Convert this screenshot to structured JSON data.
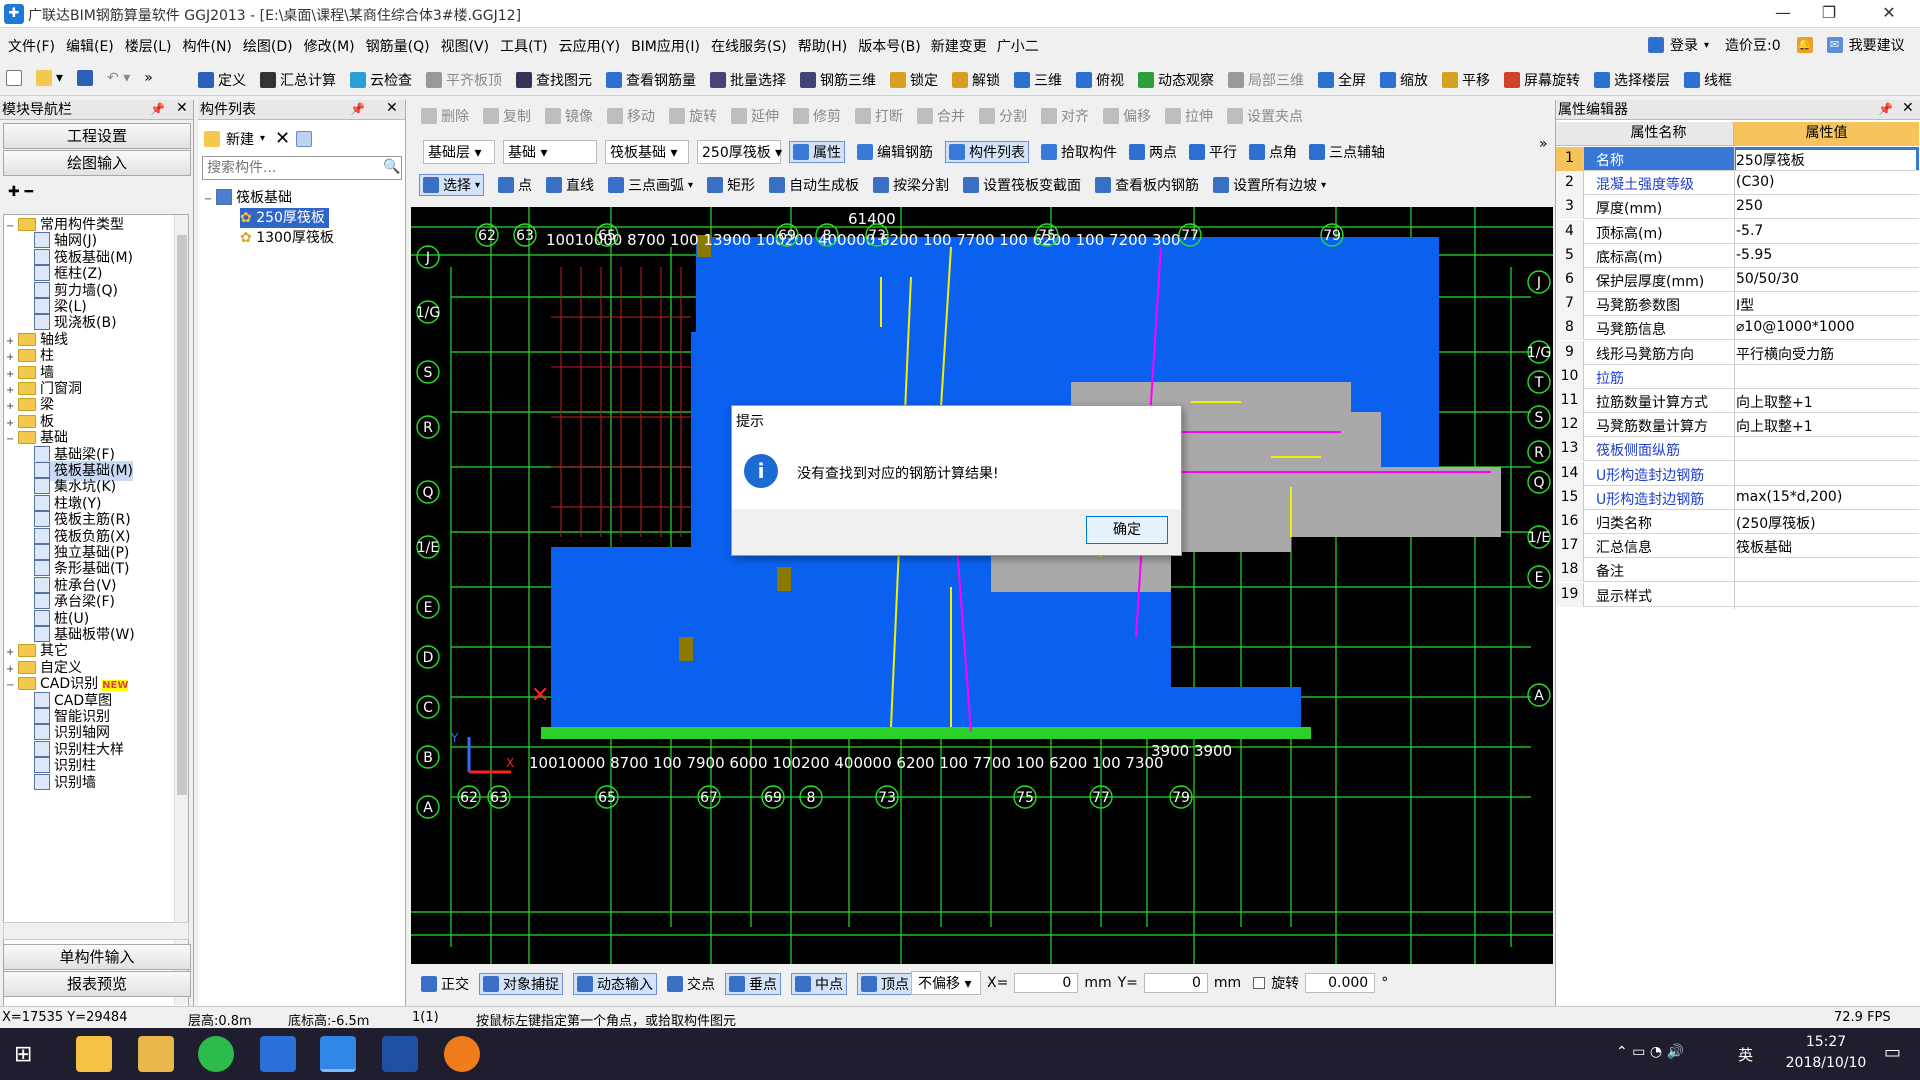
{
  "window": {
    "title": "广联达BIM钢筋算量软件 GGJ2013 - [E:\\桌面\\课程\\某商住综合体3#楼.GGJ12]"
  },
  "menu": [
    "文件(F)",
    "编辑(E)",
    "楼层(L)",
    "构件(N)",
    "绘图(D)",
    "修改(M)",
    "钢筋量(Q)",
    "视图(V)",
    "工具(T)",
    "云应用(Y)",
    "BIM应用(I)",
    "在线服务(S)",
    "帮助(H)",
    "版本号(B)",
    "新建变更",
    "广小二"
  ],
  "menu_right": {
    "login": "登录",
    "price": "造价豆:0",
    "suggest": "我要建议"
  },
  "toolbar1": [
    "定义",
    "汇总计算",
    "云检查",
    "平齐板顶",
    "查找图元",
    "查看钢筋量",
    "批量选择",
    "钢筋三维",
    "锁定",
    "解锁",
    "三维",
    "俯视",
    "动态观察",
    "局部三维",
    "全屏",
    "缩放",
    "平移",
    "屏幕旋转",
    "选择楼层",
    "线框"
  ],
  "nav": {
    "title": "模块导航栏",
    "btn_project": "工程设置",
    "btn_draw": "绘图输入",
    "btn_single": "单构件输入",
    "btn_report": "报表预览",
    "tree": [
      {
        "t": "常用构件类型",
        "lvl": 0,
        "k": "folder",
        "e": "−"
      },
      {
        "t": "轴网(J)",
        "lvl": 2,
        "k": "item"
      },
      {
        "t": "筏板基础(M)",
        "lvl": 2,
        "k": "item"
      },
      {
        "t": "框柱(Z)",
        "lvl": 2,
        "k": "item"
      },
      {
        "t": "剪力墙(Q)",
        "lvl": 2,
        "k": "item"
      },
      {
        "t": "梁(L)",
        "lvl": 2,
        "k": "item"
      },
      {
        "t": "现浇板(B)",
        "lvl": 2,
        "k": "item"
      },
      {
        "t": "轴线",
        "lvl": 0,
        "k": "folder",
        "e": "+"
      },
      {
        "t": "柱",
        "lvl": 0,
        "k": "folder",
        "e": "+"
      },
      {
        "t": "墙",
        "lvl": 0,
        "k": "folder",
        "e": "+"
      },
      {
        "t": "门窗洞",
        "lvl": 0,
        "k": "folder",
        "e": "+"
      },
      {
        "t": "梁",
        "lvl": 0,
        "k": "folder",
        "e": "+"
      },
      {
        "t": "板",
        "lvl": 0,
        "k": "folder",
        "e": "+"
      },
      {
        "t": "基础",
        "lvl": 0,
        "k": "folder",
        "e": "−"
      },
      {
        "t": "基础梁(F)",
        "lvl": 2,
        "k": "item"
      },
      {
        "t": "筏板基础(M)",
        "lvl": 2,
        "k": "item",
        "sel": true
      },
      {
        "t": "集水坑(K)",
        "lvl": 2,
        "k": "item"
      },
      {
        "t": "柱墩(Y)",
        "lvl": 2,
        "k": "item"
      },
      {
        "t": "筏板主筋(R)",
        "lvl": 2,
        "k": "item"
      },
      {
        "t": "筏板负筋(X)",
        "lvl": 2,
        "k": "item"
      },
      {
        "t": "独立基础(P)",
        "lvl": 2,
        "k": "item"
      },
      {
        "t": "条形基础(T)",
        "lvl": 2,
        "k": "item"
      },
      {
        "t": "桩承台(V)",
        "lvl": 2,
        "k": "item"
      },
      {
        "t": "承台梁(F)",
        "lvl": 2,
        "k": "item"
      },
      {
        "t": "桩(U)",
        "lvl": 2,
        "k": "item"
      },
      {
        "t": "基础板带(W)",
        "lvl": 2,
        "k": "item"
      },
      {
        "t": "其它",
        "lvl": 0,
        "k": "folder",
        "e": "+"
      },
      {
        "t": "自定义",
        "lvl": 0,
        "k": "folder",
        "e": "+"
      },
      {
        "t": "CAD识别",
        "lvl": 0,
        "k": "folder",
        "e": "−",
        "badge": "NEW"
      },
      {
        "t": "CAD草图",
        "lvl": 2,
        "k": "item"
      },
      {
        "t": "智能识别",
        "lvl": 2,
        "k": "item"
      },
      {
        "t": "识别轴网",
        "lvl": 2,
        "k": "item"
      },
      {
        "t": "识别柱大样",
        "lvl": 2,
        "k": "item"
      },
      {
        "t": "识别柱",
        "lvl": 2,
        "k": "item"
      },
      {
        "t": "识别墙",
        "lvl": 2,
        "k": "item"
      }
    ]
  },
  "complist": {
    "title": "构件列表",
    "new": "新建",
    "search_ph": "搜索构件...",
    "root": "筏板基础",
    "items": [
      "250厚筏板",
      "1300厚筏板"
    ]
  },
  "layerbar": {
    "floor": "基础层",
    "type": "基础",
    "sub": "筏板基础",
    "comp": "250厚筏板",
    "buttons": [
      "属性",
      "编辑钢筋",
      "构件列表",
      "拾取构件",
      "两点",
      "平行",
      "点角",
      "三点辅轴"
    ]
  },
  "editbar": [
    "删除",
    "复制",
    "镜像",
    "移动",
    "旋转",
    "延伸",
    "修剪",
    "打断",
    "合并",
    "分割",
    "对齐",
    "偏移",
    "拉伸",
    "设置夹点"
  ],
  "drawbar": [
    "选择",
    "点",
    "直线",
    "三点画弧",
    "矩形",
    "自动生成板",
    "按梁分割",
    "设置筏板变截面",
    "查看板内钢筋",
    "设置所有边坡"
  ],
  "props": {
    "title": "属性编辑器",
    "h_name": "属性名称",
    "h_val": "属性值",
    "rows": [
      {
        "n": "1",
        "k": "名称",
        "v": "250厚筏板",
        "blue": false
      },
      {
        "n": "2",
        "k": "混凝土强度等级",
        "v": "(C30)",
        "blue": true
      },
      {
        "n": "3",
        "k": "厚度(mm)",
        "v": "250",
        "blue": false
      },
      {
        "n": "4",
        "k": "顶标高(m)",
        "v": "-5.7",
        "blue": false
      },
      {
        "n": "5",
        "k": "底标高(m)",
        "v": "-5.95",
        "blue": false
      },
      {
        "n": "6",
        "k": "保护层厚度(mm)",
        "v": "50/50/30",
        "blue": false
      },
      {
        "n": "7",
        "k": "马凳筋参数图",
        "v": "Ⅰ型",
        "blue": false
      },
      {
        "n": "8",
        "k": "马凳筋信息",
        "v": "⌀10@1000*1000",
        "blue": false
      },
      {
        "n": "9",
        "k": "线形马凳筋方向",
        "v": "平行横向受力筋",
        "blue": false
      },
      {
        "n": "10",
        "k": "拉筋",
        "v": "",
        "blue": true
      },
      {
        "n": "11",
        "k": "拉筋数量计算方式",
        "v": "向上取整+1",
        "blue": false
      },
      {
        "n": "12",
        "k": "马凳筋数量计算方",
        "v": "向上取整+1",
        "blue": false
      },
      {
        "n": "13",
        "k": "筏板侧面纵筋",
        "v": "",
        "blue": true
      },
      {
        "n": "14",
        "k": "U形构造封边钢筋",
        "v": "",
        "blue": true
      },
      {
        "n": "15",
        "k": "U形构造封边钢筋",
        "v": "max(15*d,200)",
        "blue": true
      },
      {
        "n": "16",
        "k": "归类名称",
        "v": "(250厚筏板)",
        "blue": false
      },
      {
        "n": "17",
        "k": "汇总信息",
        "v": "筏板基础",
        "blue": false
      },
      {
        "n": "18",
        "k": "备注",
        "v": "",
        "blue": false
      },
      {
        "n": "19",
        "k": "显示样式",
        "v": "",
        "blue": false
      }
    ]
  },
  "dialog": {
    "title": "提示",
    "message": "没有查找到对应的钢筋计算结果!",
    "ok": "确定"
  },
  "cad": {
    "top_dims": "10010000  8700   100     13900     100200  400000  6200  100    7700    100  6200  100   7200   300",
    "bot_dims": "10010000   8700    100    7900       6000 100200  400000  6200  100    7700    100  6200  100    7300",
    "top_over": "61400",
    "bot_over": "3900  3900",
    "axes_top": [
      "62",
      "63",
      "65",
      "69",
      "8",
      "73",
      "75",
      "77",
      "79"
    ],
    "axes_bot": [
      "62",
      "63",
      "65",
      "67",
      "69",
      "8",
      "73",
      "75",
      "77",
      "79"
    ],
    "axes_left": [
      "J",
      "1/G",
      "S",
      "R",
      "Q",
      "1/E",
      "E",
      "D",
      "C",
      "B",
      "A"
    ],
    "axes_right": [
      "J",
      "1/G",
      "T",
      "S",
      "R",
      "Q",
      "1/E",
      "E",
      "A"
    ]
  },
  "snap": {
    "buttons": [
      "正交",
      "对象捕捉",
      "动态输入",
      "交点",
      "垂点",
      "中点",
      "顶点",
      "坐标"
    ],
    "offset": "不偏移",
    "x_label": "X=",
    "x": "0",
    "y_label": "Y=",
    "y": "0",
    "unit": "mm",
    "rotate_label": "旋转",
    "rotate": "0.000",
    "deg": "°"
  },
  "status": {
    "coords": "X=17535 Y=29484",
    "floor_h": "层高:0.8m",
    "bottom": "底标高:-6.5m",
    "count": "1(1)",
    "hint": "按鼠标左键指定第一个角点，或拾取构件图元",
    "fps": "72.9 FPS"
  },
  "taskbar": {
    "ime": "英",
    "time": "15:27",
    "date": "2018/10/10"
  }
}
